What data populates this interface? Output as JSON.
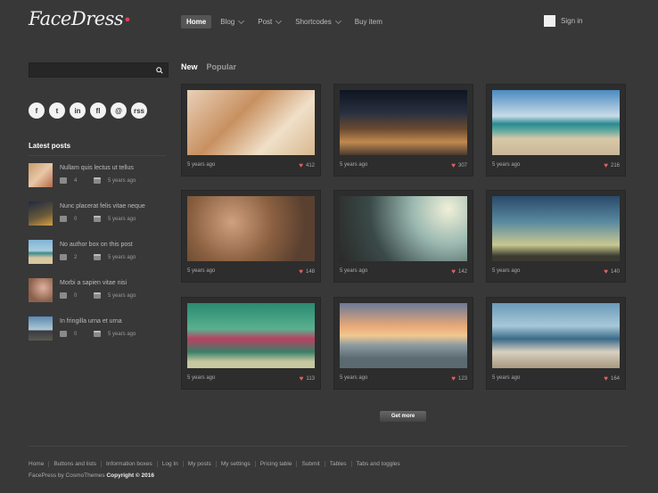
{
  "brand": {
    "name": "FaceDress"
  },
  "nav": {
    "items": [
      {
        "label": "Home",
        "caret": false,
        "active": true
      },
      {
        "label": "Blog",
        "caret": true,
        "active": false
      },
      {
        "label": "Post",
        "caret": true,
        "active": false
      },
      {
        "label": "Shortcodes",
        "caret": true,
        "active": false
      },
      {
        "label": "Buy item",
        "caret": false,
        "active": false
      }
    ],
    "signin": "Sign in"
  },
  "sidebar": {
    "search_placeholder": "",
    "social": [
      "f",
      "t",
      "in",
      "fl",
      "@",
      "rss"
    ],
    "latest_title": "Latest posts",
    "posts": [
      {
        "title": "Nullam quis lectus ut tellus",
        "comments": "4",
        "date": "5 years ago"
      },
      {
        "title": "Nunc placerat felis vitae neque",
        "comments": "0",
        "date": "5 years ago"
      },
      {
        "title": "No author box on this post",
        "comments": "2",
        "date": "5 years ago"
      },
      {
        "title": "Morbi a sapien vitae nisi",
        "comments": "0",
        "date": "5 years ago"
      },
      {
        "title": "In fringilla urna et urna",
        "comments": "0",
        "date": "5 years ago"
      }
    ]
  },
  "tabs": {
    "new": "New",
    "popular": "Popular"
  },
  "cards": [
    {
      "time": "5 years ago",
      "likes": "412"
    },
    {
      "time": "5 years ago",
      "likes": "307"
    },
    {
      "time": "5 years ago",
      "likes": "216"
    },
    {
      "time": "5 years ago",
      "likes": "148"
    },
    {
      "time": "5 years ago",
      "likes": "142"
    },
    {
      "time": "5 years ago",
      "likes": "140"
    },
    {
      "time": "5 years ago",
      "likes": "113"
    },
    {
      "time": "5 years ago",
      "likes": "123"
    },
    {
      "time": "5 years ago",
      "likes": "164"
    }
  ],
  "more_button": "Get more",
  "footer": {
    "links": [
      "Home",
      "Buttons and lists",
      "Information boxes",
      "Log In",
      "My posts",
      "My settings",
      "Pricing table",
      "Submit",
      "Tables",
      "Tabs and toggles"
    ],
    "copyright_prefix": "FacePress by CosmoThemes",
    "copyright_bold": "Copyright © 2016"
  }
}
